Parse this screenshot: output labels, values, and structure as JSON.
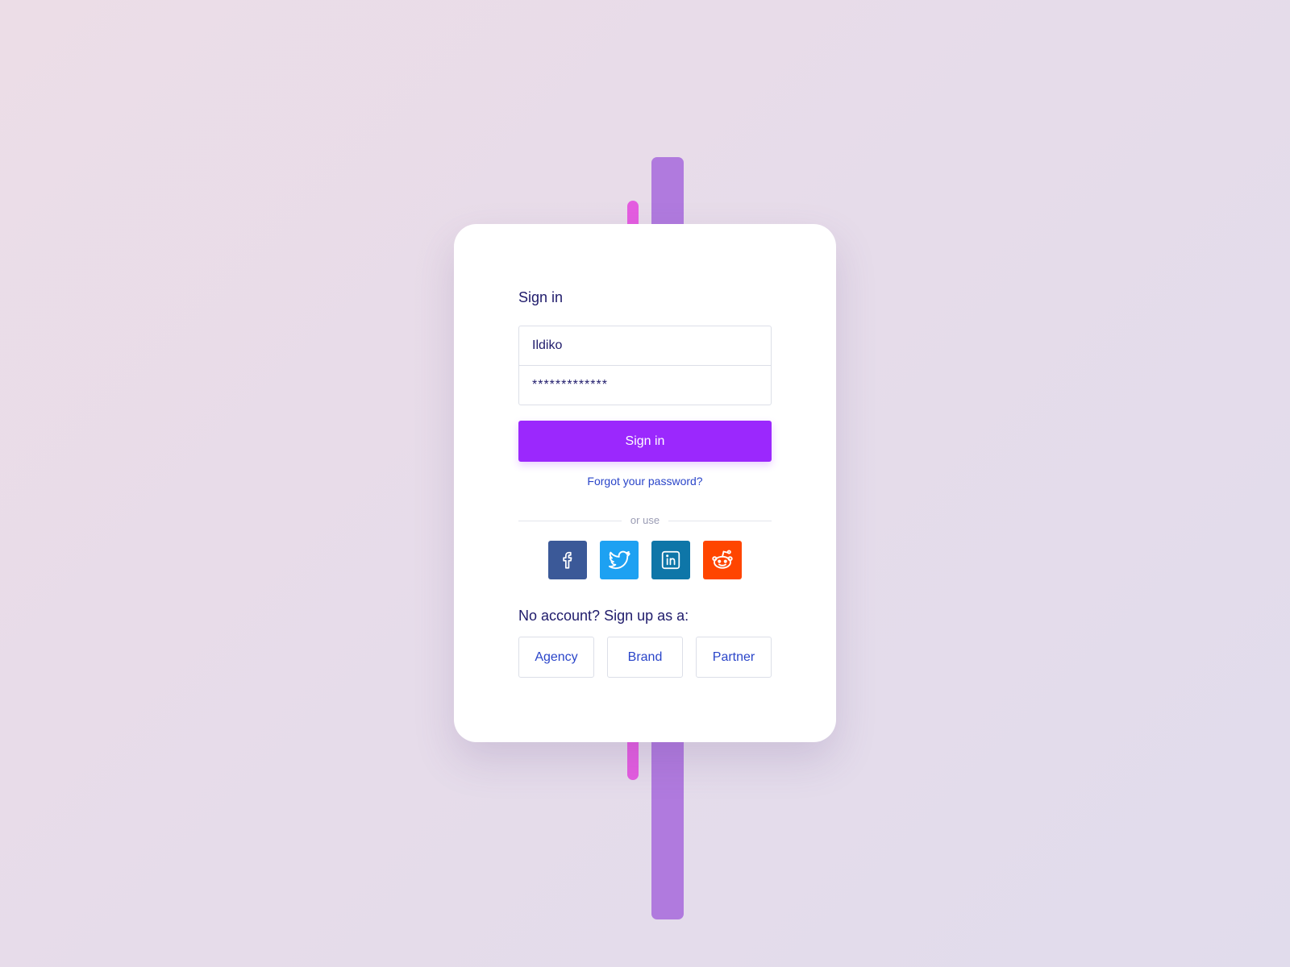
{
  "signin": {
    "title": "Sign in",
    "username_value": "Ildiko",
    "password_value": "*************",
    "submit_label": "Sign in",
    "forgot_label": "Forgot your password?",
    "divider_label": "or use"
  },
  "social": [
    {
      "name": "facebook",
      "icon": "facebook-icon",
      "color": "#3b5998"
    },
    {
      "name": "twitter",
      "icon": "twitter-icon",
      "color": "#1da1f2"
    },
    {
      "name": "linkedin",
      "icon": "linkedin-icon",
      "color": "#0e76a8"
    },
    {
      "name": "reddit",
      "icon": "reddit-icon",
      "color": "#ff4500"
    }
  ],
  "signup": {
    "title": "No account? Sign up as a:",
    "options": [
      "Agency",
      "Brand",
      "Partner"
    ]
  },
  "colors": {
    "accent": "#9b28fd",
    "link": "#2a45c9",
    "heading": "#1f1b6b",
    "bar_purple": "#b07ade",
    "bar_pink": "#e45de0"
  }
}
